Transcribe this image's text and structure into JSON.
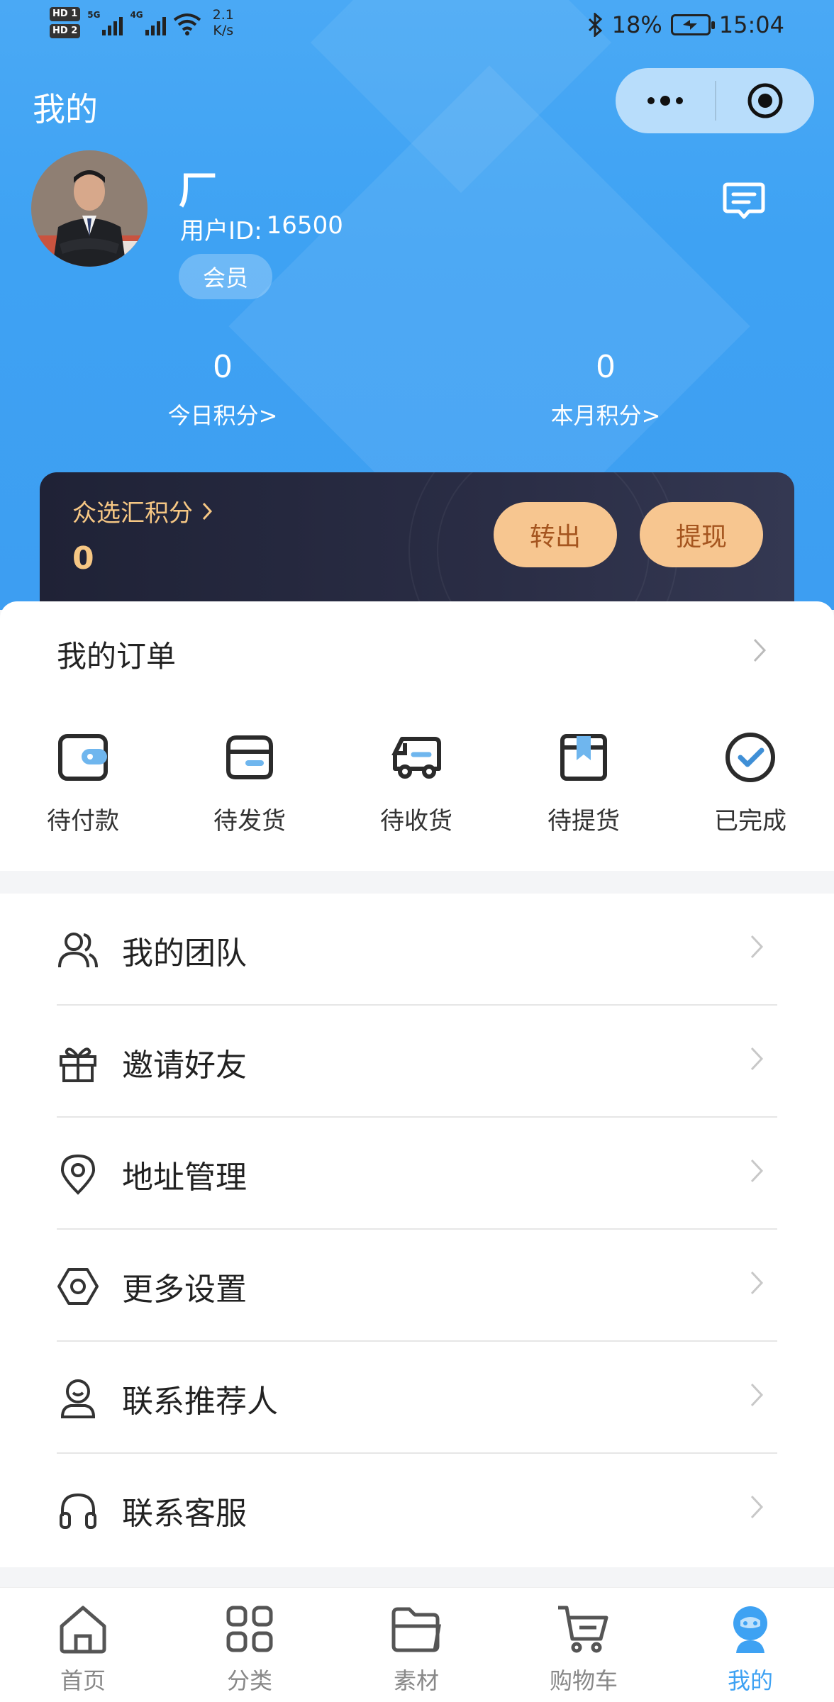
{
  "status_bar": {
    "sim1": "HD 1",
    "sim2": "HD 2",
    "net1": "5G",
    "net2": "4G",
    "speed_value": "2.1",
    "speed_unit": "K/s",
    "battery": "18%",
    "time": "15:04"
  },
  "header": {
    "title": "我的",
    "capsule_more": "•••"
  },
  "profile": {
    "name": "厂",
    "id_label": "用户ID:",
    "id_value": "16500",
    "badge": "会员"
  },
  "stats": {
    "today_value": "0",
    "today_label": "今日积分>",
    "month_value": "0",
    "month_label": "本月积分>"
  },
  "points_card": {
    "title": "众选汇积分",
    "value": "0",
    "transfer_label": "转出",
    "withdraw_label": "提现"
  },
  "orders": {
    "title": "我的订单",
    "items": [
      {
        "label": "待付款",
        "icon": "wallet-icon"
      },
      {
        "label": "待发货",
        "icon": "card-box-icon"
      },
      {
        "label": "待收货",
        "icon": "truck-icon"
      },
      {
        "label": "待提货",
        "icon": "package-icon"
      },
      {
        "label": "已完成",
        "icon": "check-circle-icon"
      }
    ]
  },
  "menu": {
    "items": [
      {
        "label": "我的团队",
        "icon": "team-icon"
      },
      {
        "label": "邀请好友",
        "icon": "gift-icon"
      },
      {
        "label": "地址管理",
        "icon": "location-icon"
      },
      {
        "label": "更多设置",
        "icon": "settings-icon"
      },
      {
        "label": "联系推荐人",
        "icon": "contact-icon"
      },
      {
        "label": "联系客服",
        "icon": "headset-icon"
      }
    ]
  },
  "tabbar": {
    "items": [
      {
        "label": "首页",
        "icon": "home-icon"
      },
      {
        "label": "分类",
        "icon": "grid-icon"
      },
      {
        "label": "素材",
        "icon": "folder-icon"
      },
      {
        "label": "购物车",
        "icon": "cart-icon"
      },
      {
        "label": "我的",
        "icon": "profile-icon"
      }
    ],
    "active_color": "#3ea2f3"
  },
  "colors": {
    "primary": "#3ea2f3",
    "gold": "#f6c784",
    "card_dark": "#23263b"
  }
}
